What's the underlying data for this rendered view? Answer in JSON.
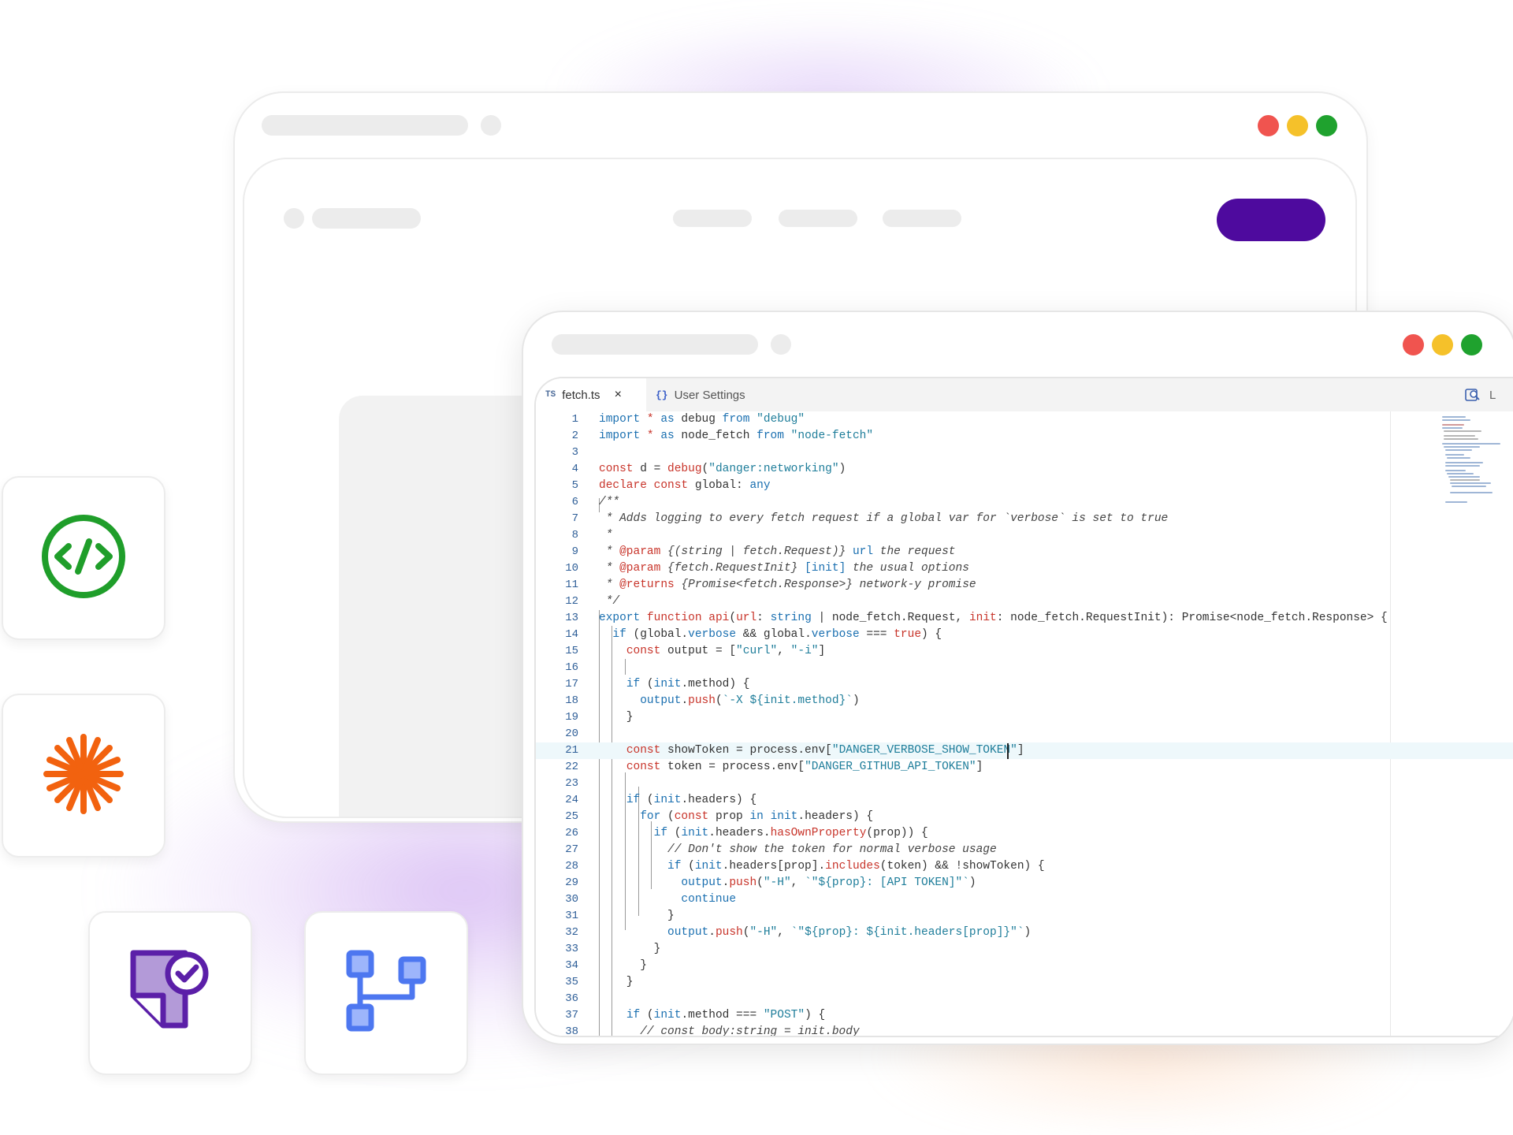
{
  "colors": {
    "traffic_red": "#f0544f",
    "traffic_yellow": "#f5c12a",
    "traffic_green": "#1fa22e",
    "cta_purple": "#4e0a9e",
    "code_icon_green": "#1f9e2a",
    "burst_orange": "#f2620f",
    "doc_icon_purple": "#5b1fa8",
    "flow_icon_blue": "#4d77f0"
  },
  "tiles": [
    {
      "icon": "code-brackets-icon"
    },
    {
      "icon": "starburst-icon"
    },
    {
      "icon": "document-check-icon"
    },
    {
      "icon": "flowchart-icon"
    }
  ],
  "editor": {
    "tabs": [
      {
        "badge": "TS",
        "label": "fetch.ts",
        "close": "×"
      },
      {
        "badge": "{}",
        "label": "User Settings"
      }
    ],
    "overflow_tab": "L"
  }
}
